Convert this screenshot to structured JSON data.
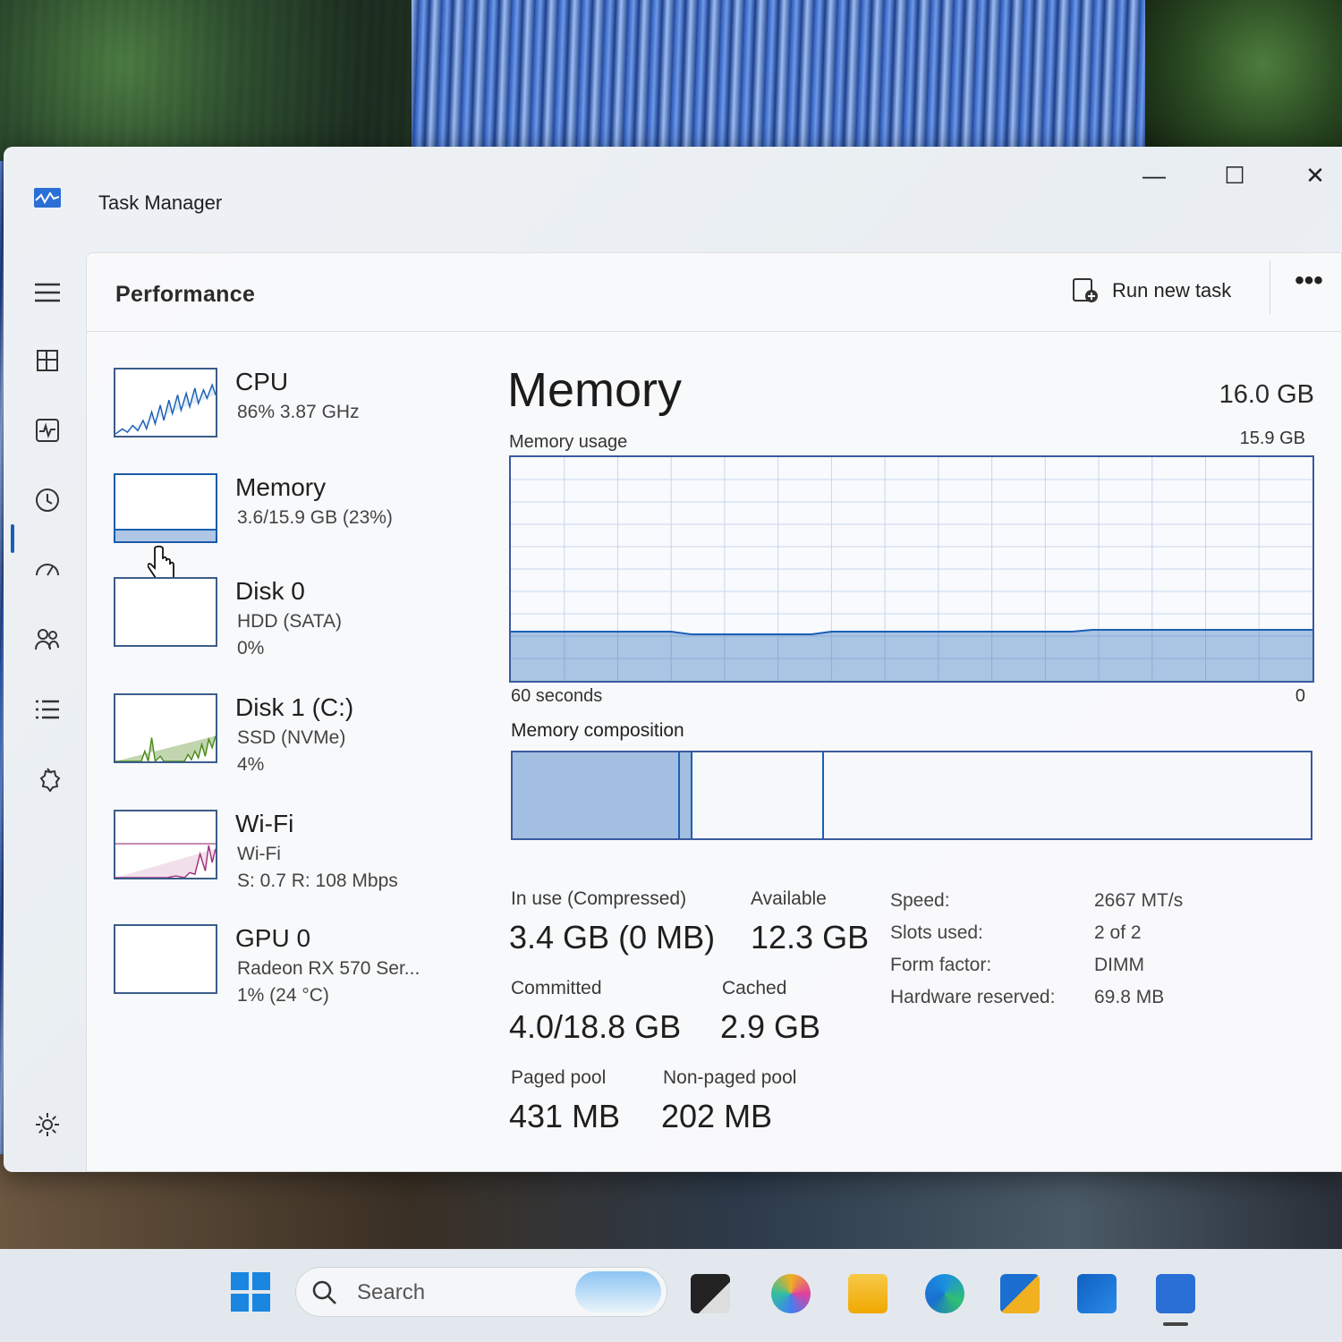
{
  "window": {
    "title": "Task Manager",
    "minimize_glyph": "—",
    "maximize_glyph": "☐",
    "close_glyph": "✕"
  },
  "header": {
    "page_title": "Performance",
    "run_new_task": "Run new task",
    "more": "•••"
  },
  "rail": {
    "items": [
      {
        "icon": "hamburger-menu-icon",
        "active": false
      },
      {
        "icon": "processes-icon",
        "active": false
      },
      {
        "icon": "performance-icon",
        "active": true
      },
      {
        "icon": "app-history-icon",
        "active": false
      },
      {
        "icon": "startup-apps-icon",
        "active": false
      },
      {
        "icon": "users-icon",
        "active": false
      },
      {
        "icon": "details-icon",
        "active": false
      },
      {
        "icon": "services-icon",
        "active": false
      },
      {
        "icon": "settings-icon",
        "active": false
      }
    ]
  },
  "devices": [
    {
      "name": "CPU",
      "sub1": "86% 3.87 GHz",
      "sub2": "",
      "sub3": "",
      "color": "#1a5fb4"
    },
    {
      "name": "Memory",
      "sub1": "3.6/15.9 GB (23%)",
      "sub2": "",
      "sub3": "",
      "color": "#1a5fb4"
    },
    {
      "name": "Disk 0",
      "sub1": "HDD (SATA)",
      "sub2": "0%",
      "sub3": "",
      "color": "#4d8a1b"
    },
    {
      "name": "Disk 1 (C:)",
      "sub1": "SSD (NVMe)",
      "sub2": "4%",
      "sub3": "",
      "color": "#4d8a1b"
    },
    {
      "name": "Wi-Fi",
      "sub1": "Wi-Fi",
      "sub2": "S: 0.7 R: 108 Mbps",
      "sub3": "",
      "color": "#a0307a"
    },
    {
      "name": "GPU 0",
      "sub1": "Radeon RX 570 Ser...",
      "sub2": "1% (24 °C)",
      "sub3": "",
      "color": "#1a5fb4"
    }
  ],
  "memory": {
    "title": "Memory",
    "total": "16.0 GB",
    "usage_label": "Memory usage",
    "usage_max": "15.9 GB",
    "axis_left": "60 seconds",
    "axis_right": "0",
    "composition_label": "Memory composition",
    "usage_fraction": 0.22,
    "composition": {
      "in_use_fraction": 0.21,
      "modified_fraction": 0.015,
      "standby_fraction": 0.165
    },
    "stats": {
      "in_use_label": "In use (Compressed)",
      "in_use_value": "3.4 GB (0 MB)",
      "available_label": "Available",
      "available_value": "12.3 GB",
      "committed_label": "Committed",
      "committed_value": "4.0/18.8 GB",
      "cached_label": "Cached",
      "cached_value": "2.9 GB",
      "paged_label": "Paged pool",
      "paged_value": "431 MB",
      "nonpaged_label": "Non-paged pool",
      "nonpaged_value": "202 MB"
    },
    "specs": [
      {
        "label": "Speed:",
        "value": "2667 MT/s"
      },
      {
        "label": "Slots used:",
        "value": "2 of 2"
      },
      {
        "label": "Form factor:",
        "value": "DIMM"
      },
      {
        "label": "Hardware reserved:",
        "value": "69.8 MB"
      }
    ]
  },
  "taskbar": {
    "search_placeholder": "Search",
    "apps": [
      "start-icon",
      "task-view-icon",
      "copilot-icon",
      "file-explorer-icon",
      "edge-icon",
      "store-icon",
      "outlook-icon",
      "task-manager-icon"
    ]
  }
}
